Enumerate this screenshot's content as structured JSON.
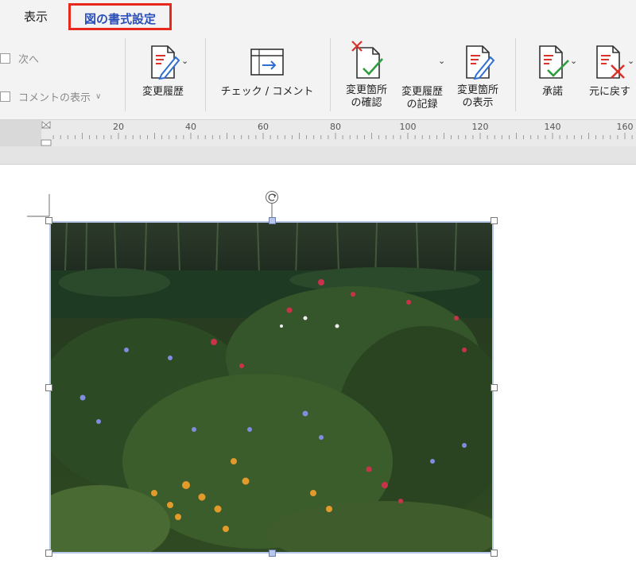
{
  "tabs": {
    "view_label": "表示",
    "format_picture_label": "図の書式設定"
  },
  "ribbon": {
    "next_label": "次へ",
    "show_comments_label": "コメントの表示",
    "track_changes_label": "変更履歴",
    "check_comment_label": "チェック / コメント",
    "review_changes_label_1": "変更箇所",
    "review_changes_label_2": "の確認",
    "record_changes_label_1": "変更履歴",
    "record_changes_label_2": "の記録",
    "show_changes_label_1": "変更箇所",
    "show_changes_label_2": "の表示",
    "accept_label": "承諾",
    "reject_label": "元に戻す",
    "icons": [
      "track-changes-icon",
      "check-comment-icon",
      "review-changes-icon",
      "record-changes-icon",
      "show-changes-icon",
      "accept-icon",
      "reject-icon",
      "chevron-down-icon"
    ]
  },
  "ruler": {
    "labels": [
      "20",
      "40",
      "60",
      "80",
      "100",
      "120",
      "140",
      "160"
    ]
  },
  "colors": {
    "accent": "#2b4fb8",
    "highlight_box": "#e8281c",
    "selection": "#b9c8ea"
  }
}
